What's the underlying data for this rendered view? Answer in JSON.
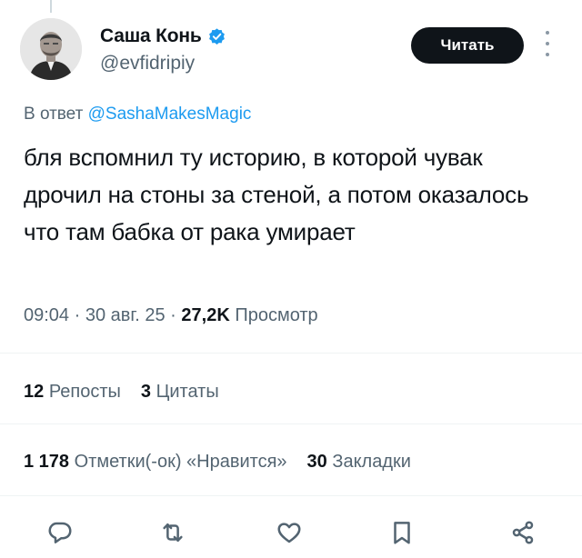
{
  "author": {
    "display_name": "Саша Конь",
    "handle": "@evfidripiy",
    "verified": true
  },
  "follow_button": {
    "label": "Читать"
  },
  "reply_to": {
    "prefix": "В ответ ",
    "mention": "@SashaMakesMagic"
  },
  "tweet": {
    "text": "бля вспомнил ту историю, в которой чувак дрочил на стоны за стеной, а потом оказалось что там бабка от рака умирает"
  },
  "meta": {
    "time": "09:04",
    "date": "30 авг. 25",
    "views_count": "27,2K",
    "views_label": "Просмотр"
  },
  "stats": {
    "reposts_count": "12",
    "reposts_label": "Репосты",
    "quotes_count": "3",
    "quotes_label": "Цитаты",
    "likes_count": "1 178",
    "likes_label": "Отметки(-ок) «Нравится»",
    "bookmarks_count": "30",
    "bookmarks_label": "Закладки"
  },
  "colors": {
    "accent": "#1d9bf0",
    "text_primary": "#0f1419",
    "text_secondary": "#536471",
    "button_bg": "#0f1419"
  },
  "icons": {
    "verified": "verified-badge-icon",
    "more": "more-vertical-icon",
    "reply": "reply-icon",
    "repost": "repost-icon",
    "like": "heart-icon",
    "bookmark": "bookmark-icon",
    "share": "share-icon"
  }
}
